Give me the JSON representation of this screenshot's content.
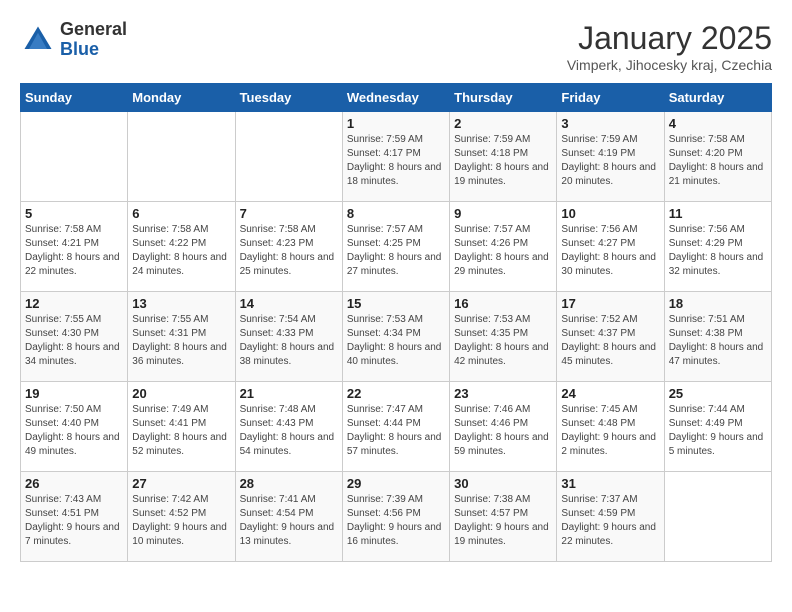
{
  "header": {
    "logo_general": "General",
    "logo_blue": "Blue",
    "title": "January 2025",
    "subtitle": "Vimperk, Jihocesky kraj, Czechia"
  },
  "weekdays": [
    "Sunday",
    "Monday",
    "Tuesday",
    "Wednesday",
    "Thursday",
    "Friday",
    "Saturday"
  ],
  "weeks": [
    [
      {
        "day": "",
        "sunrise": "",
        "sunset": "",
        "daylight": ""
      },
      {
        "day": "",
        "sunrise": "",
        "sunset": "",
        "daylight": ""
      },
      {
        "day": "",
        "sunrise": "",
        "sunset": "",
        "daylight": ""
      },
      {
        "day": "1",
        "sunrise": "Sunrise: 7:59 AM",
        "sunset": "Sunset: 4:17 PM",
        "daylight": "Daylight: 8 hours and 18 minutes."
      },
      {
        "day": "2",
        "sunrise": "Sunrise: 7:59 AM",
        "sunset": "Sunset: 4:18 PM",
        "daylight": "Daylight: 8 hours and 19 minutes."
      },
      {
        "day": "3",
        "sunrise": "Sunrise: 7:59 AM",
        "sunset": "Sunset: 4:19 PM",
        "daylight": "Daylight: 8 hours and 20 minutes."
      },
      {
        "day": "4",
        "sunrise": "Sunrise: 7:58 AM",
        "sunset": "Sunset: 4:20 PM",
        "daylight": "Daylight: 8 hours and 21 minutes."
      }
    ],
    [
      {
        "day": "5",
        "sunrise": "Sunrise: 7:58 AM",
        "sunset": "Sunset: 4:21 PM",
        "daylight": "Daylight: 8 hours and 22 minutes."
      },
      {
        "day": "6",
        "sunrise": "Sunrise: 7:58 AM",
        "sunset": "Sunset: 4:22 PM",
        "daylight": "Daylight: 8 hours and 24 minutes."
      },
      {
        "day": "7",
        "sunrise": "Sunrise: 7:58 AM",
        "sunset": "Sunset: 4:23 PM",
        "daylight": "Daylight: 8 hours and 25 minutes."
      },
      {
        "day": "8",
        "sunrise": "Sunrise: 7:57 AM",
        "sunset": "Sunset: 4:25 PM",
        "daylight": "Daylight: 8 hours and 27 minutes."
      },
      {
        "day": "9",
        "sunrise": "Sunrise: 7:57 AM",
        "sunset": "Sunset: 4:26 PM",
        "daylight": "Daylight: 8 hours and 29 minutes."
      },
      {
        "day": "10",
        "sunrise": "Sunrise: 7:56 AM",
        "sunset": "Sunset: 4:27 PM",
        "daylight": "Daylight: 8 hours and 30 minutes."
      },
      {
        "day": "11",
        "sunrise": "Sunrise: 7:56 AM",
        "sunset": "Sunset: 4:29 PM",
        "daylight": "Daylight: 8 hours and 32 minutes."
      }
    ],
    [
      {
        "day": "12",
        "sunrise": "Sunrise: 7:55 AM",
        "sunset": "Sunset: 4:30 PM",
        "daylight": "Daylight: 8 hours and 34 minutes."
      },
      {
        "day": "13",
        "sunrise": "Sunrise: 7:55 AM",
        "sunset": "Sunset: 4:31 PM",
        "daylight": "Daylight: 8 hours and 36 minutes."
      },
      {
        "day": "14",
        "sunrise": "Sunrise: 7:54 AM",
        "sunset": "Sunset: 4:33 PM",
        "daylight": "Daylight: 8 hours and 38 minutes."
      },
      {
        "day": "15",
        "sunrise": "Sunrise: 7:53 AM",
        "sunset": "Sunset: 4:34 PM",
        "daylight": "Daylight: 8 hours and 40 minutes."
      },
      {
        "day": "16",
        "sunrise": "Sunrise: 7:53 AM",
        "sunset": "Sunset: 4:35 PM",
        "daylight": "Daylight: 8 hours and 42 minutes."
      },
      {
        "day": "17",
        "sunrise": "Sunrise: 7:52 AM",
        "sunset": "Sunset: 4:37 PM",
        "daylight": "Daylight: 8 hours and 45 minutes."
      },
      {
        "day": "18",
        "sunrise": "Sunrise: 7:51 AM",
        "sunset": "Sunset: 4:38 PM",
        "daylight": "Daylight: 8 hours and 47 minutes."
      }
    ],
    [
      {
        "day": "19",
        "sunrise": "Sunrise: 7:50 AM",
        "sunset": "Sunset: 4:40 PM",
        "daylight": "Daylight: 8 hours and 49 minutes."
      },
      {
        "day": "20",
        "sunrise": "Sunrise: 7:49 AM",
        "sunset": "Sunset: 4:41 PM",
        "daylight": "Daylight: 8 hours and 52 minutes."
      },
      {
        "day": "21",
        "sunrise": "Sunrise: 7:48 AM",
        "sunset": "Sunset: 4:43 PM",
        "daylight": "Daylight: 8 hours and 54 minutes."
      },
      {
        "day": "22",
        "sunrise": "Sunrise: 7:47 AM",
        "sunset": "Sunset: 4:44 PM",
        "daylight": "Daylight: 8 hours and 57 minutes."
      },
      {
        "day": "23",
        "sunrise": "Sunrise: 7:46 AM",
        "sunset": "Sunset: 4:46 PM",
        "daylight": "Daylight: 8 hours and 59 minutes."
      },
      {
        "day": "24",
        "sunrise": "Sunrise: 7:45 AM",
        "sunset": "Sunset: 4:48 PM",
        "daylight": "Daylight: 9 hours and 2 minutes."
      },
      {
        "day": "25",
        "sunrise": "Sunrise: 7:44 AM",
        "sunset": "Sunset: 4:49 PM",
        "daylight": "Daylight: 9 hours and 5 minutes."
      }
    ],
    [
      {
        "day": "26",
        "sunrise": "Sunrise: 7:43 AM",
        "sunset": "Sunset: 4:51 PM",
        "daylight": "Daylight: 9 hours and 7 minutes."
      },
      {
        "day": "27",
        "sunrise": "Sunrise: 7:42 AM",
        "sunset": "Sunset: 4:52 PM",
        "daylight": "Daylight: 9 hours and 10 minutes."
      },
      {
        "day": "28",
        "sunrise": "Sunrise: 7:41 AM",
        "sunset": "Sunset: 4:54 PM",
        "daylight": "Daylight: 9 hours and 13 minutes."
      },
      {
        "day": "29",
        "sunrise": "Sunrise: 7:39 AM",
        "sunset": "Sunset: 4:56 PM",
        "daylight": "Daylight: 9 hours and 16 minutes."
      },
      {
        "day": "30",
        "sunrise": "Sunrise: 7:38 AM",
        "sunset": "Sunset: 4:57 PM",
        "daylight": "Daylight: 9 hours and 19 minutes."
      },
      {
        "day": "31",
        "sunrise": "Sunrise: 7:37 AM",
        "sunset": "Sunset: 4:59 PM",
        "daylight": "Daylight: 9 hours and 22 minutes."
      },
      {
        "day": "",
        "sunrise": "",
        "sunset": "",
        "daylight": ""
      }
    ]
  ]
}
